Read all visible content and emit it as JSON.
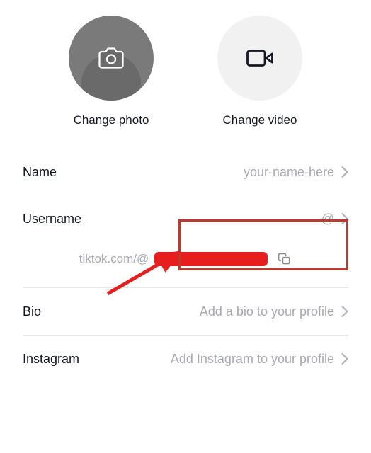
{
  "media": {
    "photo_label": "Change photo",
    "video_label": "Change video"
  },
  "rows": {
    "name": {
      "label": "Name",
      "value": "your-name-here"
    },
    "username": {
      "label": "Username",
      "value": "@"
    },
    "bio": {
      "label": "Bio",
      "value": "Add a bio to your profile"
    },
    "instagram": {
      "label": "Instagram",
      "value": "Add Instagram to your profile"
    }
  },
  "profile_url_prefix": "tiktok.com/@"
}
